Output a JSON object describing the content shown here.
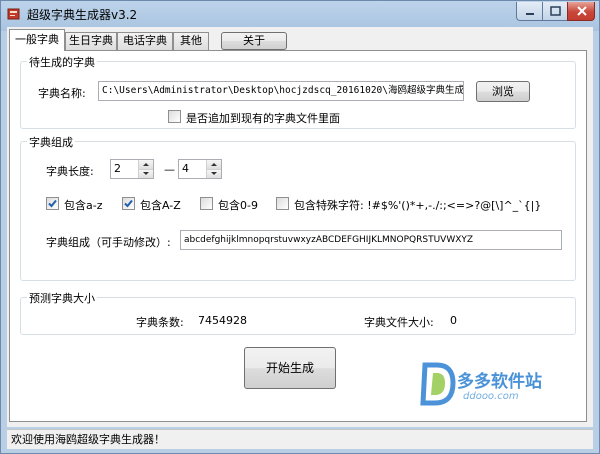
{
  "window": {
    "title": "超级字典生成器v3.2"
  },
  "tabs": [
    {
      "label": "一般字典",
      "active": true
    },
    {
      "label": "生日字典",
      "active": false
    },
    {
      "label": "电话字典",
      "active": false
    },
    {
      "label": "其他",
      "active": false
    }
  ],
  "about_label": "关于",
  "source_group": {
    "title": "待生成的字典",
    "name_label": "字典名称:",
    "name_value": "C:\\Users\\Administrator\\Desktop\\hocjzdscq_20161020\\海鸥超级字典生成",
    "browse_label": "浏览",
    "append_label": "是否追加到现有的字典文件里面",
    "append_checked": false
  },
  "compose_group": {
    "title": "字典组成",
    "length_label": "字典长度:",
    "length_min": "2",
    "dash": "—",
    "length_max": "4",
    "options": [
      {
        "label": "包含a-z",
        "checked": true
      },
      {
        "label": "包含A-Z",
        "checked": true
      },
      {
        "label": "包含0-9",
        "checked": false
      },
      {
        "label": "包含特殊字符: !#$%'()*+,-./:;<=>?@[\\]^_`{|}",
        "checked": false
      }
    ],
    "charset_label": "字典组成（可手动修改）:",
    "charset_value": "abcdefghijklmnopqrstuvwxyzABCDEFGHIJKLMNOPQRSTUVWXYZ"
  },
  "predict_group": {
    "title": "预测字典大小",
    "count_label": "字典条数:",
    "count_value": "7454928",
    "size_label": "字典文件大小:",
    "size_value": "0"
  },
  "start_label": "开始生成",
  "statusbar": {
    "text": "欢迎使用海鸥超级字典生成器！"
  },
  "watermark": {
    "brand": "多多软件站",
    "url": "ddooo.com"
  },
  "colors": {
    "accent_blue": "#2b7fd1",
    "close_red": "#c8463a",
    "check_blue": "#1f5fae"
  }
}
